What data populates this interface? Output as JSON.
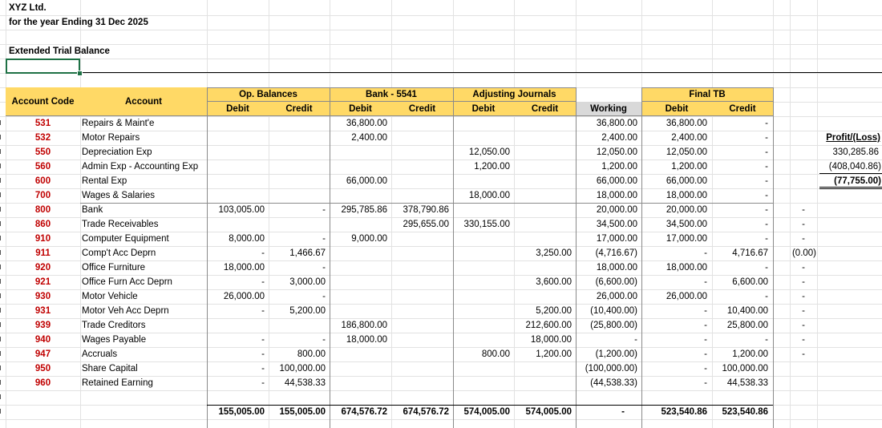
{
  "header": {
    "company": "XYZ Ltd.",
    "period": "for the year Ending 31 Dec 2025",
    "report": "Extended Trial Balance"
  },
  "columns": {
    "account_code": "Account Code",
    "account": "Account",
    "groups": [
      "Op. Balances",
      "Bank - 5541",
      "Adjusting Journals",
      "Final TB"
    ],
    "debit": "Debit",
    "credit": "Credit",
    "working": "Working"
  },
  "rows": [
    {
      "code": "531",
      "account": "Repairs & Maint'e",
      "op_dr": "",
      "op_cr": "",
      "bank_dr": "36,800.00",
      "bank_cr": "",
      "adj_dr": "",
      "adj_cr": "",
      "working": "36,800.00",
      "ftb_dr": "36,800.00",
      "ftb_cr": "-",
      "x1": "",
      "x2": ""
    },
    {
      "code": "532",
      "account": "Motor Repairs",
      "op_dr": "",
      "op_cr": "",
      "bank_dr": "2,400.00",
      "bank_cr": "",
      "adj_dr": "",
      "adj_cr": "",
      "working": "2,400.00",
      "ftb_dr": "2,400.00",
      "ftb_cr": "-",
      "x1": "",
      "x2": ""
    },
    {
      "code": "550",
      "account": "Depreciation Exp",
      "op_dr": "",
      "op_cr": "",
      "bank_dr": "",
      "bank_cr": "",
      "adj_dr": "12,050.00",
      "adj_cr": "",
      "working": "12,050.00",
      "ftb_dr": "12,050.00",
      "ftb_cr": "-",
      "x1": "",
      "x2": ""
    },
    {
      "code": "560",
      "account": "Admin Exp - Accounting Exp",
      "op_dr": "",
      "op_cr": "",
      "bank_dr": "",
      "bank_cr": "",
      "adj_dr": "1,200.00",
      "adj_cr": "",
      "working": "1,200.00",
      "ftb_dr": "1,200.00",
      "ftb_cr": "-",
      "x1": "",
      "x2": ""
    },
    {
      "code": "600",
      "account": "Rental Exp",
      "op_dr": "",
      "op_cr": "",
      "bank_dr": "66,000.00",
      "bank_cr": "",
      "adj_dr": "",
      "adj_cr": "",
      "working": "66,000.00",
      "ftb_dr": "66,000.00",
      "ftb_cr": "-",
      "x1": "",
      "x2": ""
    },
    {
      "code": "700",
      "account": "Wages & Salaries",
      "op_dr": "",
      "op_cr": "",
      "bank_dr": "",
      "bank_cr": "",
      "adj_dr": "18,000.00",
      "adj_cr": "",
      "working": "18,000.00",
      "ftb_dr": "18,000.00",
      "ftb_cr": "-",
      "x1": "",
      "x2": ""
    },
    {
      "code": "800",
      "account": "Bank",
      "op_dr": "103,005.00",
      "op_cr": "-",
      "bank_dr": "295,785.86",
      "bank_cr": "378,790.86",
      "adj_dr": "",
      "adj_cr": "",
      "working": "20,000.00",
      "ftb_dr": "20,000.00",
      "ftb_cr": "-",
      "x1": "",
      "x2": "-"
    },
    {
      "code": "860",
      "account": "Trade Receivables",
      "op_dr": "",
      "op_cr": "",
      "bank_dr": "",
      "bank_cr": "295,655.00",
      "adj_dr": "330,155.00",
      "adj_cr": "",
      "working": "34,500.00",
      "ftb_dr": "34,500.00",
      "ftb_cr": "-",
      "x1": "",
      "x2": "-"
    },
    {
      "code": "910",
      "account": "Computer Equipment",
      "op_dr": "8,000.00",
      "op_cr": "-",
      "bank_dr": "9,000.00",
      "bank_cr": "",
      "adj_dr": "",
      "adj_cr": "",
      "working": "17,000.00",
      "ftb_dr": "17,000.00",
      "ftb_cr": "-",
      "x1": "",
      "x2": "-"
    },
    {
      "code": "911",
      "account": "Comp't Acc Deprn",
      "op_dr": "-",
      "op_cr": "1,466.67",
      "bank_dr": "",
      "bank_cr": "",
      "adj_dr": "",
      "adj_cr": "3,250.00",
      "working": "(4,716.67)",
      "ftb_dr": "-",
      "ftb_cr": "4,716.67",
      "x1": "(0.00)",
      "x2": ""
    },
    {
      "code": "920",
      "account": "Office Furniture",
      "op_dr": "18,000.00",
      "op_cr": "-",
      "bank_dr": "",
      "bank_cr": "",
      "adj_dr": "",
      "adj_cr": "",
      "working": "18,000.00",
      "ftb_dr": "18,000.00",
      "ftb_cr": "-",
      "x1": "",
      "x2": "-"
    },
    {
      "code": "921",
      "account": "Office Furn Acc Deprn",
      "op_dr": "-",
      "op_cr": "3,000.00",
      "bank_dr": "",
      "bank_cr": "",
      "adj_dr": "",
      "adj_cr": "3,600.00",
      "working": "(6,600.00)",
      "ftb_dr": "-",
      "ftb_cr": "6,600.00",
      "x1": "",
      "x2": "-"
    },
    {
      "code": "930",
      "account": "Motor Vehicle",
      "op_dr": "26,000.00",
      "op_cr": "-",
      "bank_dr": "",
      "bank_cr": "",
      "adj_dr": "",
      "adj_cr": "",
      "working": "26,000.00",
      "ftb_dr": "26,000.00",
      "ftb_cr": "-",
      "x1": "",
      "x2": "-"
    },
    {
      "code": "931",
      "account": "Motor Veh Acc Deprn",
      "op_dr": "-",
      "op_cr": "5,200.00",
      "bank_dr": "",
      "bank_cr": "",
      "adj_dr": "",
      "adj_cr": "5,200.00",
      "working": "(10,400.00)",
      "ftb_dr": "-",
      "ftb_cr": "10,400.00",
      "x1": "",
      "x2": "-"
    },
    {
      "code": "939",
      "account": "Trade Creditors",
      "op_dr": "",
      "op_cr": "",
      "bank_dr": "186,800.00",
      "bank_cr": "",
      "adj_dr": "",
      "adj_cr": "212,600.00",
      "working": "(25,800.00)",
      "ftb_dr": "-",
      "ftb_cr": "25,800.00",
      "x1": "",
      "x2": "-"
    },
    {
      "code": "940",
      "account": "Wages Payable",
      "op_dr": "-",
      "op_cr": "-",
      "bank_dr": "18,000.00",
      "bank_cr": "",
      "adj_dr": "",
      "adj_cr": "18,000.00",
      "working": "-",
      "ftb_dr": "-",
      "ftb_cr": "-",
      "x1": "",
      "x2": "-"
    },
    {
      "code": "947",
      "account": "Accruals",
      "op_dr": "-",
      "op_cr": "800.00",
      "bank_dr": "",
      "bank_cr": "",
      "adj_dr": "800.00",
      "adj_cr": "1,200.00",
      "working": "(1,200.00)",
      "ftb_dr": "-",
      "ftb_cr": "1,200.00",
      "x1": "",
      "x2": "-"
    },
    {
      "code": "950",
      "account": "Share Capital",
      "op_dr": "-",
      "op_cr": "100,000.00",
      "bank_dr": "",
      "bank_cr": "",
      "adj_dr": "",
      "adj_cr": "",
      "working": "(100,000.00)",
      "ftb_dr": "-",
      "ftb_cr": "100,000.00",
      "x1": "",
      "x2": ""
    },
    {
      "code": "960",
      "account": "Retained Earning",
      "op_dr": "-",
      "op_cr": "44,538.33",
      "bank_dr": "",
      "bank_cr": "",
      "adj_dr": "",
      "adj_cr": "",
      "working": "(44,538.33)",
      "ftb_dr": "-",
      "ftb_cr": "44,538.33",
      "x1": "",
      "x2": ""
    }
  ],
  "totals": {
    "op_dr": "155,005.00",
    "op_cr": "155,005.00",
    "bank_dr": "674,576.72",
    "bank_cr": "674,576.72",
    "adj_dr": "574,005.00",
    "adj_cr": "574,005.00",
    "working": "-",
    "ftb_dr": "523,540.86",
    "ftb_cr": "523,540.86"
  },
  "profit_loss": {
    "label": "Profit/(Loss)",
    "values": [
      "330,285.86",
      "(408,040.86)",
      "(77,755.00)"
    ]
  }
}
